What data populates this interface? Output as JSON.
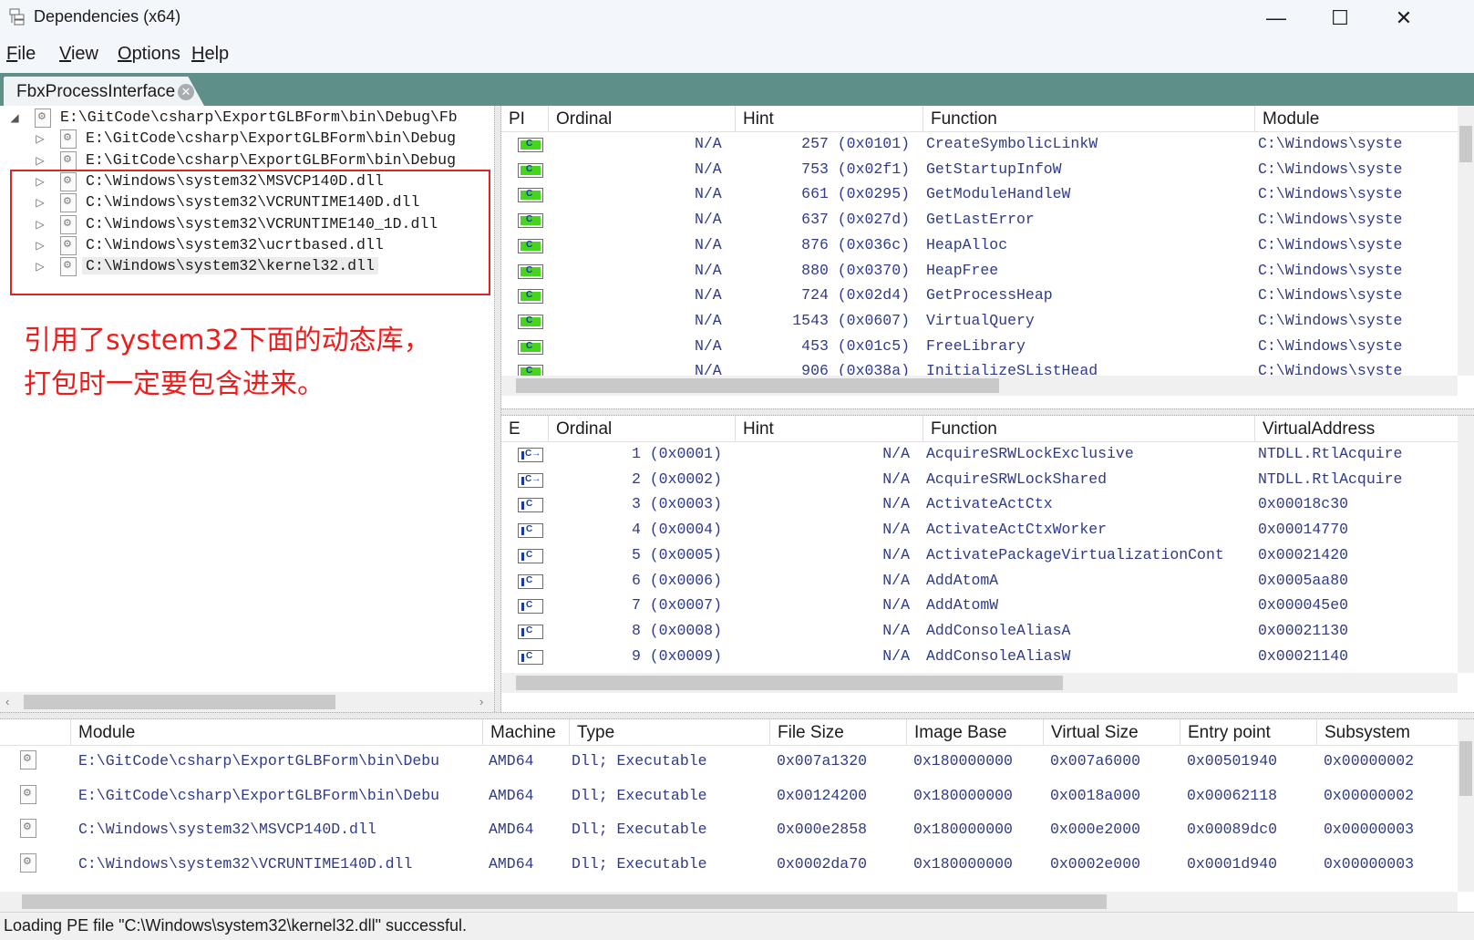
{
  "window": {
    "title": "Dependencies (x64)",
    "minimize": "—",
    "maximize": "☐",
    "close": "✕"
  },
  "menu": [
    {
      "label": "File",
      "key": "F",
      "rest": "ile"
    },
    {
      "label": "View",
      "key": "V",
      "rest": "iew"
    },
    {
      "label": "Options",
      "key": "O",
      "rest": "ptions"
    },
    {
      "label": "Help",
      "key": "H",
      "rest": "elp"
    }
  ],
  "tab": {
    "label": "FbxProcessInterface",
    "close": "✕"
  },
  "tree": [
    {
      "text": "E:\\GitCode\\csharp\\ExportGLBForm\\bin\\Debug\\Fb",
      "level": 0,
      "expanded": true
    },
    {
      "text": "E:\\GitCode\\csharp\\ExportGLBForm\\bin\\Debug",
      "level": 1
    },
    {
      "text": "E:\\GitCode\\csharp\\ExportGLBForm\\bin\\Debug",
      "level": 1
    },
    {
      "text": "C:\\Windows\\system32\\MSVCP140D.dll",
      "level": 1
    },
    {
      "text": "C:\\Windows\\system32\\VCRUNTIME140D.dll",
      "level": 1
    },
    {
      "text": "C:\\Windows\\system32\\VCRUNTIME140_1D.dll",
      "level": 1
    },
    {
      "text": "C:\\Windows\\system32\\ucrtbased.dll",
      "level": 1
    },
    {
      "text": "C:\\Windows\\system32\\kernel32.dll",
      "level": 1,
      "selected": true
    }
  ],
  "annotation": {
    "line1": "引用了system32下面的动态库，",
    "line2": "打包时一定要包含进来。"
  },
  "imports": {
    "headers": [
      "PI",
      "Ordinal",
      "Hint",
      "Function",
      "Module"
    ],
    "rows": [
      {
        "ordinal": "N/A",
        "hint": "257 (0x0101)",
        "function": "CreateSymbolicLinkW",
        "module": "C:\\Windows\\syste"
      },
      {
        "ordinal": "N/A",
        "hint": "753 (0x02f1)",
        "function": "GetStartupInfoW",
        "module": "C:\\Windows\\syste"
      },
      {
        "ordinal": "N/A",
        "hint": "661 (0x0295)",
        "function": "GetModuleHandleW",
        "module": "C:\\Windows\\syste"
      },
      {
        "ordinal": "N/A",
        "hint": "637 (0x027d)",
        "function": "GetLastError",
        "module": "C:\\Windows\\syste"
      },
      {
        "ordinal": "N/A",
        "hint": "876 (0x036c)",
        "function": "HeapAlloc",
        "module": "C:\\Windows\\syste"
      },
      {
        "ordinal": "N/A",
        "hint": "880 (0x0370)",
        "function": "HeapFree",
        "module": "C:\\Windows\\syste"
      },
      {
        "ordinal": "N/A",
        "hint": "724 (0x02d4)",
        "function": "GetProcessHeap",
        "module": "C:\\Windows\\syste"
      },
      {
        "ordinal": "N/A",
        "hint": "1543 (0x0607)",
        "function": "VirtualQuery",
        "module": "C:\\Windows\\syste"
      },
      {
        "ordinal": "N/A",
        "hint": "453 (0x01c5)",
        "function": "FreeLibrary",
        "module": "C:\\Windows\\syste"
      },
      {
        "ordinal": "N/A",
        "hint": "906 (0x038a)",
        "function": "InitializeSListHead",
        "module": "C:\\Windows\\syste"
      }
    ]
  },
  "exports": {
    "headers": [
      "E",
      "Ordinal",
      "Hint",
      "Function",
      "VirtualAddress"
    ],
    "rows": [
      {
        "ordinal": "1 (0x0001)",
        "hint": "N/A",
        "function": "AcquireSRWLockExclusive",
        "address": "NTDLL.RtlAcquire",
        "fwd": true
      },
      {
        "ordinal": "2 (0x0002)",
        "hint": "N/A",
        "function": "AcquireSRWLockShared",
        "address": "NTDLL.RtlAcquire",
        "fwd": true
      },
      {
        "ordinal": "3 (0x0003)",
        "hint": "N/A",
        "function": "ActivateActCtx",
        "address": "0x00018c30"
      },
      {
        "ordinal": "4 (0x0004)",
        "hint": "N/A",
        "function": "ActivateActCtxWorker",
        "address": "0x00014770"
      },
      {
        "ordinal": "5 (0x0005)",
        "hint": "N/A",
        "function": "ActivatePackageVirtualizationCont",
        "address": "0x00021420"
      },
      {
        "ordinal": "6 (0x0006)",
        "hint": "N/A",
        "function": "AddAtomA",
        "address": "0x0005aa80"
      },
      {
        "ordinal": "7 (0x0007)",
        "hint": "N/A",
        "function": "AddAtomW",
        "address": "0x000045e0"
      },
      {
        "ordinal": "8 (0x0008)",
        "hint": "N/A",
        "function": "AddConsoleAliasA",
        "address": "0x00021130"
      },
      {
        "ordinal": "9 (0x0009)",
        "hint": "N/A",
        "function": "AddConsoleAliasW",
        "address": "0x00021140"
      }
    ]
  },
  "modules": {
    "headers": [
      "",
      "Module",
      "Machine",
      "Type",
      "File Size",
      "Image Base",
      "Virtual Size",
      "Entry point",
      "Subsystem"
    ],
    "rows": [
      {
        "module": "E:\\GitCode\\csharp\\ExportGLBForm\\bin\\Debu",
        "machine": "AMD64",
        "type": "Dll; Executable",
        "file_size": "0x007a1320",
        "image_base": "0x180000000",
        "virtual_size": "0x007a6000",
        "entry": "0x00501940",
        "subsystem": "0x00000002"
      },
      {
        "module": "E:\\GitCode\\csharp\\ExportGLBForm\\bin\\Debu",
        "machine": "AMD64",
        "type": "Dll; Executable",
        "file_size": "0x00124200",
        "image_base": "0x180000000",
        "virtual_size": "0x0018a000",
        "entry": "0x00062118",
        "subsystem": "0x00000002"
      },
      {
        "module": "C:\\Windows\\system32\\MSVCP140D.dll",
        "machine": "AMD64",
        "type": "Dll; Executable",
        "file_size": "0x000e2858",
        "image_base": "0x180000000",
        "virtual_size": "0x000e2000",
        "entry": "0x00089dc0",
        "subsystem": "0x00000003"
      },
      {
        "module": "C:\\Windows\\system32\\VCRUNTIME140D.dll",
        "machine": "AMD64",
        "type": "Dll; Executable",
        "file_size": "0x0002da70",
        "image_base": "0x180000000",
        "virtual_size": "0x0002e000",
        "entry": "0x0001d940",
        "subsystem": "0x00000003"
      }
    ]
  },
  "status": "Loading PE file \"C:\\Windows\\system32\\kernel32.dll\" successful."
}
